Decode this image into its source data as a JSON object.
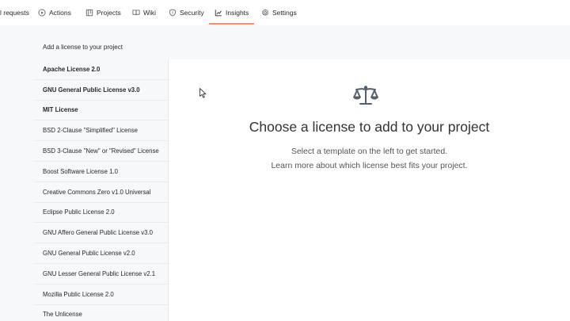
{
  "nav": {
    "tabs": [
      {
        "label": "l requests",
        "icon": "pull-request-icon"
      },
      {
        "label": "Actions",
        "icon": "play-icon"
      },
      {
        "label": "Projects",
        "icon": "table-icon"
      },
      {
        "label": "Wiki",
        "icon": "book-icon"
      },
      {
        "label": "Security",
        "icon": "shield-icon"
      },
      {
        "label": "Insights",
        "icon": "graph-icon"
      },
      {
        "label": "Settings",
        "icon": "gear-icon"
      }
    ],
    "active_tab": "Insights",
    "active_color": "#fd8c73"
  },
  "list_header": "Add a license to your project",
  "licenses": [
    {
      "label": "Apache License 2.0",
      "bold": true
    },
    {
      "label": "GNU General Public License v3.0",
      "bold": true
    },
    {
      "label": "MIT License",
      "bold": true
    },
    {
      "label": "BSD 2-Clause \"Simplified\" License",
      "bold": false
    },
    {
      "label": "BSD 3-Clause \"New\" or \"Revised\" License",
      "bold": false
    },
    {
      "label": "Boost Software License 1.0",
      "bold": false
    },
    {
      "label": "Creative Commons Zero v1.0 Universal",
      "bold": false
    },
    {
      "label": "Eclipse Public License 2.0",
      "bold": false
    },
    {
      "label": "GNU Affero General Public License v3.0",
      "bold": false
    },
    {
      "label": "GNU General Public License v2.0",
      "bold": false
    },
    {
      "label": "GNU Lesser General Public License v2.1",
      "bold": false
    },
    {
      "label": "Mozilla Public License 2.0",
      "bold": false
    },
    {
      "label": "The Unlicense",
      "bold": false
    }
  ],
  "main": {
    "icon": "law-scale-icon",
    "title": "Choose a license to add to your project",
    "subtitle_line1": "Select a template on the left to get started.",
    "subtitle_line2": "Learn more about which license best fits your project."
  }
}
